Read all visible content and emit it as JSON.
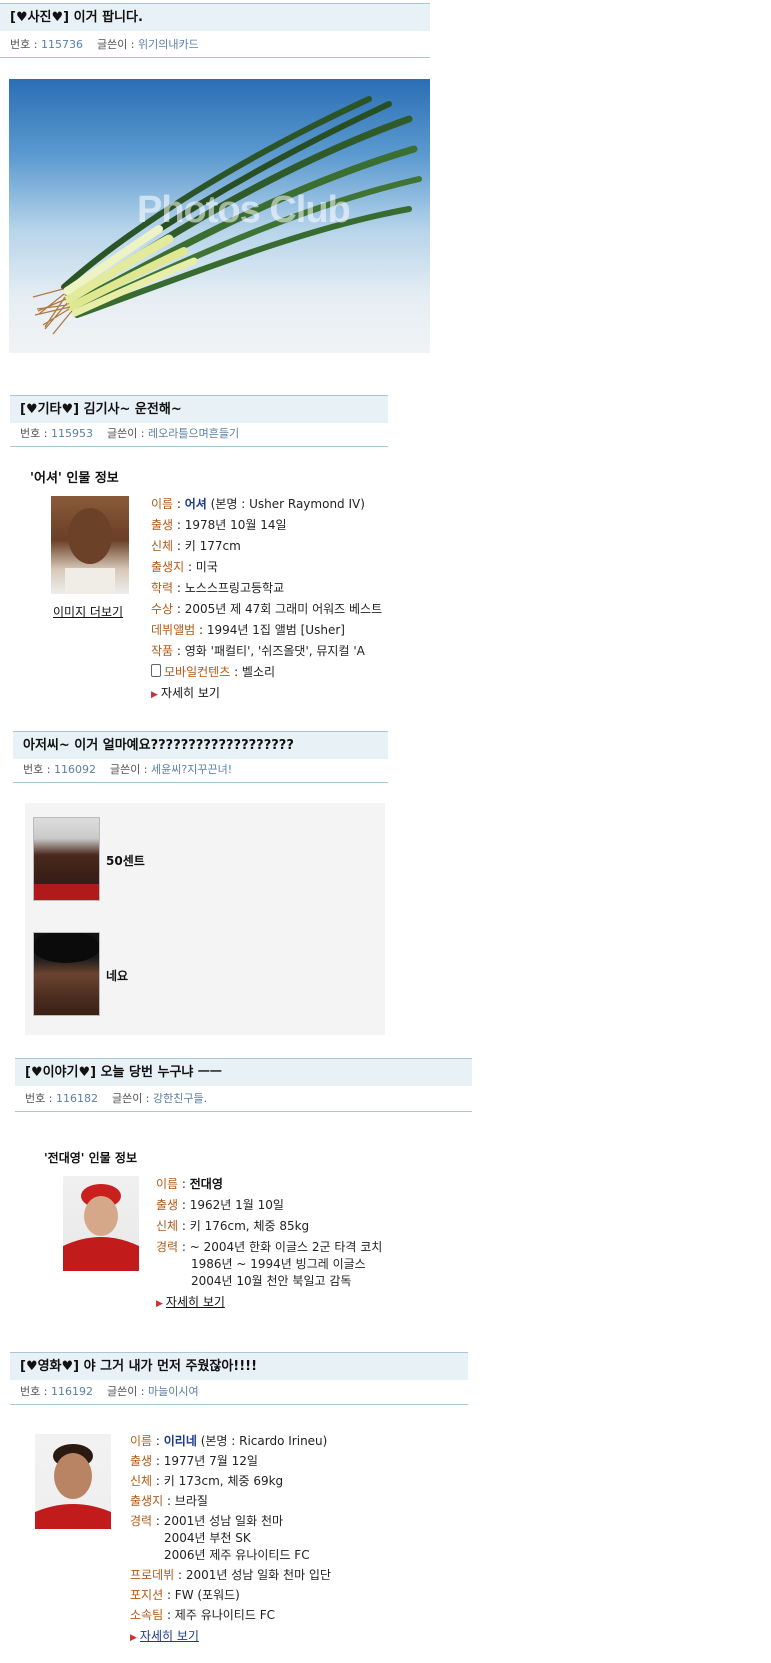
{
  "posts": [
    {
      "title": "[♥사진♥] 이거 팝니다.",
      "number_label": "번호 : ",
      "number": "115736",
      "author_label": "글쓴이 : ",
      "author": "위기의내카드",
      "photo_watermark": "Photos Club"
    },
    {
      "title": "[♥기타♥] 김기사~ 운전해~",
      "number_label": "번호 : ",
      "number": "115953",
      "author_label": "글쓴이 : ",
      "author": "레오라틀으며흔들기",
      "info_title": "'어셔' 인물 정보",
      "more_images": "이미지 더보기",
      "rows": [
        {
          "k": "이름",
          "v_name": "어셔",
          "v": " (본명 : Usher Raymond IV)"
        },
        {
          "k": "출생",
          "v": "1978년 10월 14일"
        },
        {
          "k": "신체",
          "v": "키 177cm"
        },
        {
          "k": "출생지",
          "v": "미국"
        },
        {
          "k": "학력",
          "v": "노스스프링고등학교"
        },
        {
          "k": "수상",
          "v": "2005년 제 47회 그래미 어워즈 베스트"
        },
        {
          "k": "데뷔앨범",
          "v": "1994년 1집 앨범 [Usher]"
        },
        {
          "k": "작품",
          "v": "영화 '패컬티', '쉬즈올댓', 뮤지컬 'A"
        },
        {
          "k": "모바일컨텐츠",
          "v": "벨소리"
        }
      ],
      "more": "자세히 보기"
    },
    {
      "title": "아저씨~ 이거 얼마예요???????????????????",
      "number_label": "번호 : ",
      "number": "116092",
      "author_label": "글쓴이 : ",
      "author": "세윤씨?지꾸끈녀!",
      "people": [
        "50센트",
        "네요"
      ]
    },
    {
      "title": "[♥이야기♥] 오늘 당번 누구냐 ㅡㅡ",
      "number_label": "번호 : ",
      "number": "116182",
      "author_label": "글쓴이 : ",
      "author": "강한친구들.",
      "info_title": "'전대영' 인물 정보",
      "rows": [
        {
          "k": "이름",
          "v_name": "전대영",
          "v": ""
        },
        {
          "k": "출생",
          "v": "1962년 1월 10일"
        },
        {
          "k": "신체",
          "v": "키 176cm, 체중 85kg"
        },
        {
          "k": "경력",
          "v": "~ 2004년 한화 이글스 2군 타격 코치"
        }
      ],
      "career_extra": [
        "1986년 ~ 1994년 빙그레 이글스",
        "2004년 10월 천안 북일고 감독"
      ],
      "more": "자세히 보기"
    },
    {
      "title": "[♥영화♥] 야 그거 내가 먼저 주웠잖아!!!!",
      "number_label": "번호 : ",
      "number": "116192",
      "author_label": "글쓴이 : ",
      "author": "마늘이시여",
      "rows": [
        {
          "k": "이름",
          "v_name": "이리네",
          "v": " (본명 : Ricardo Irineu)"
        },
        {
          "k": "출생",
          "v": "1977년 7월 12일"
        },
        {
          "k": "신체",
          "v": "키 173cm, 체중 69kg"
        },
        {
          "k": "출생지",
          "v": "브라질"
        },
        {
          "k": "경력",
          "v": "2001년 성남 일화 천마"
        }
      ],
      "career_extra": [
        "2004년 부천 SK",
        "2006년 제주 유나이티드 FC"
      ],
      "rows2": [
        {
          "k": "프로데뷔",
          "v": "2001년 성남 일화 천마 입단"
        },
        {
          "k": "포지션",
          "v": "FW (포워드)"
        },
        {
          "k": "소속팀",
          "v": "제주 유나이티드 FC"
        }
      ],
      "more": "자세히 보기"
    }
  ]
}
